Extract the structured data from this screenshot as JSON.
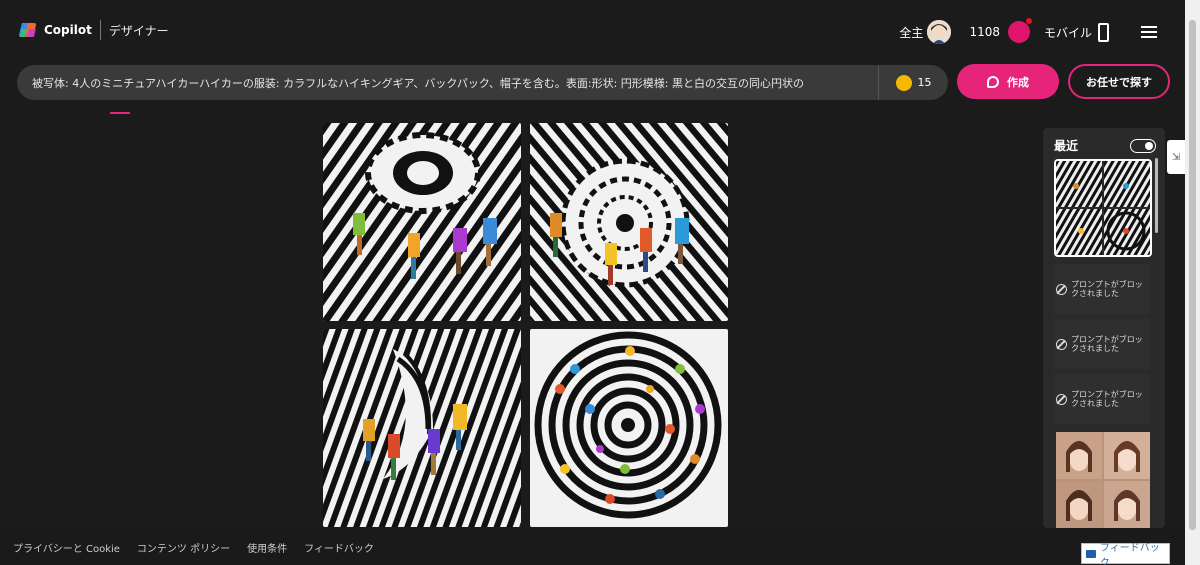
{
  "header": {
    "brand": "Copilot",
    "designer": "デザイナー",
    "user_label": "全主",
    "boost_count": "1108",
    "mobile_label": "モバイル"
  },
  "prompt": {
    "text": "被写体: 4人のミニチュアハイカーハイカーの服装: カラフルなハイキングギア、バックパック、帽子を含む。表面:形状: 円形模様: 黒と白の交互の同心円状の",
    "coin_count": "15"
  },
  "actions": {
    "create_label": "作成",
    "surprise_label": "お任せで探す"
  },
  "sidebar": {
    "title": "最近",
    "blocked_items": [
      "プロンプトがブロックされました",
      "プロンプトがブロックされました",
      "プロンプトがブロックされました"
    ]
  },
  "footer": {
    "links": [
      "プライバシーと Cookie",
      "コンテンツ ポリシー",
      "使用条件",
      "フィードバック"
    ],
    "feedback_button": "フィードバック"
  },
  "colors": {
    "accent": "#e5247a",
    "background": "#1c1b1b",
    "coin": "#f5b800"
  }
}
